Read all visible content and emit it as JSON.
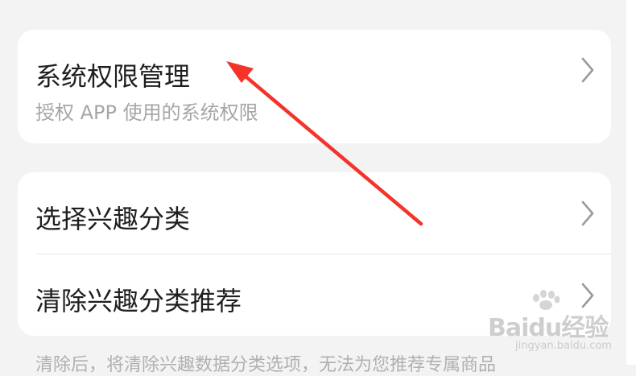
{
  "permissions_card": {
    "title": "系统权限管理",
    "subtitle": "授权 APP 使用的系统权限"
  },
  "interest_card": {
    "items": [
      {
        "label": "选择兴趣分类"
      },
      {
        "label": "清除兴趣分类推荐"
      }
    ]
  },
  "footnote": "清除后，将清除兴趣数据分类选项，无法为您推荐专属商品",
  "watermark": {
    "brand": "Baidu经验",
    "url": "jingyan.baidu.com"
  },
  "colors": {
    "background": "#f3f3f3",
    "card": "#ffffff",
    "arrow": "#f2342a",
    "title_text": "#1f1f1f",
    "subtitle_text": "#a6a6a6"
  },
  "icons": {
    "row_chevron": "chevron-right-icon",
    "annotation": "red-arrow-annotation"
  }
}
